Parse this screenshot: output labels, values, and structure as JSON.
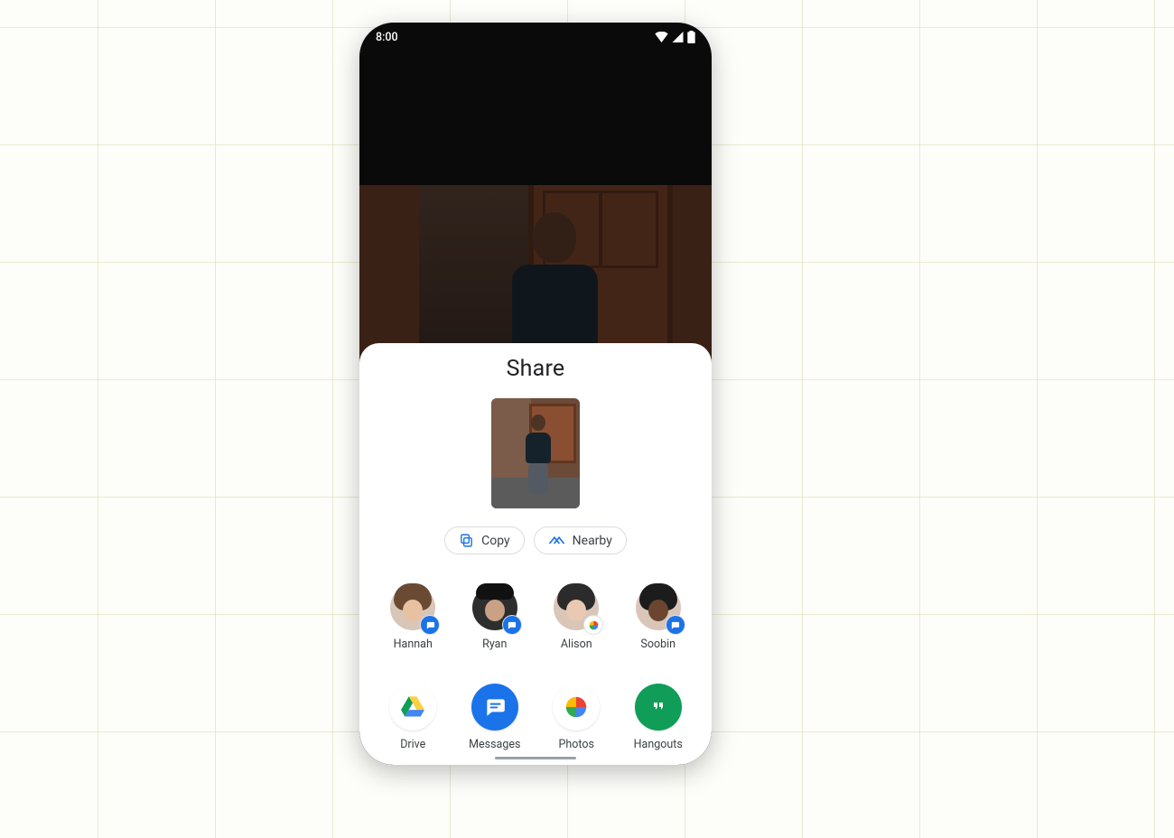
{
  "status_bar": {
    "time": "8:00"
  },
  "sheet": {
    "title": "Share",
    "actions": {
      "copy": "Copy",
      "nearby": "Nearby"
    },
    "contacts": [
      {
        "name": "Hannah",
        "badge": "messages"
      },
      {
        "name": "Ryan",
        "badge": "messages"
      },
      {
        "name": "Alison",
        "badge": "photos"
      },
      {
        "name": "Soobin",
        "badge": "messages"
      }
    ],
    "apps": [
      {
        "name": "Drive"
      },
      {
        "name": "Messages"
      },
      {
        "name": "Photos"
      },
      {
        "name": "Hangouts"
      }
    ]
  },
  "colors": {
    "google_blue": "#1a73e8",
    "hangouts_green": "#0f9d58",
    "drive_yellow": "#ffcf44",
    "drive_green": "#0f9d58",
    "drive_blue": "#4285f4"
  }
}
